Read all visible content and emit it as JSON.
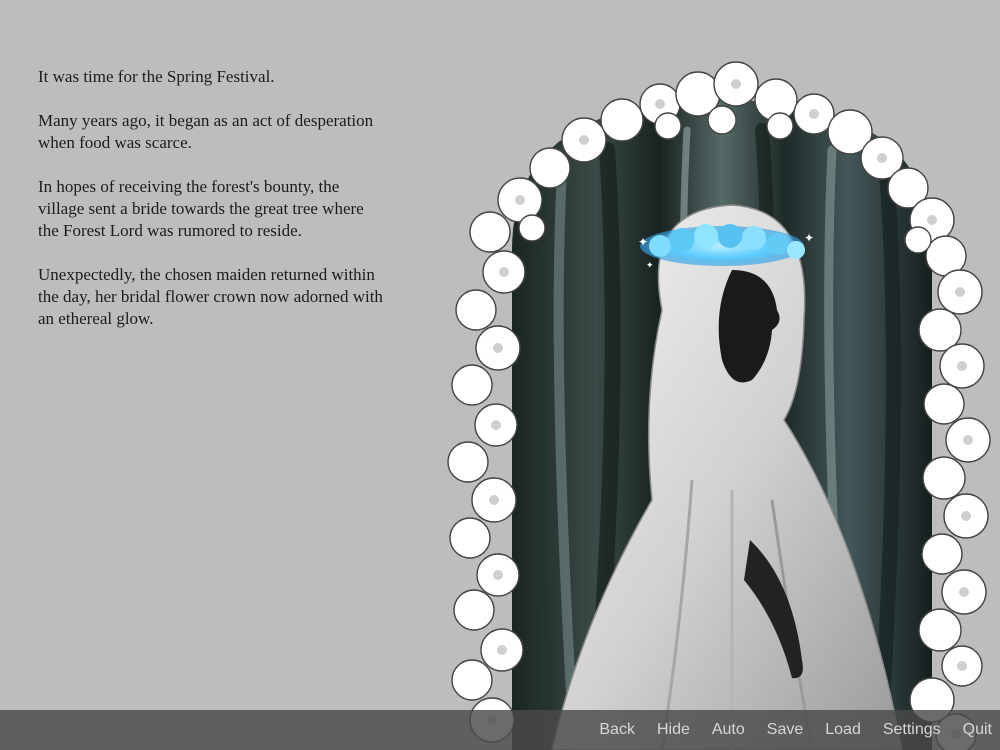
{
  "story": {
    "paragraphs": [
      "It was time for the Spring Festival.",
      "Many years ago, it began as an act of desperation when food was scarce.",
      "In hopes of receiving the forest's bounty, the village sent a bride towards the great tree where the Forest Lord was rumored to reside.",
      "Unexpectedly, the chosen maiden returned within the day, her bridal flower crown now adorned with an ethereal glow."
    ]
  },
  "quick_menu": {
    "back": "Back",
    "hide": "Hide",
    "auto": "Auto",
    "save": "Save",
    "load": "Load",
    "settings": "Settings",
    "quit": "Quit"
  },
  "colors": {
    "background": "#bdbdbd",
    "menu_bar": "#4b4b4b",
    "crown_glow": "#6fd3ff"
  },
  "icons": [
    "flower-arch-art",
    "bride-silhouette",
    "glowing-flower-crown"
  ]
}
